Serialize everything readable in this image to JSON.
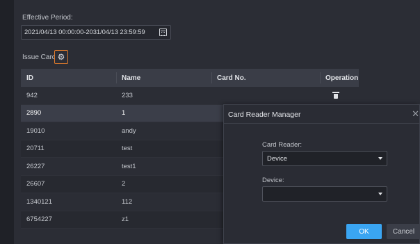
{
  "effective_period": {
    "label": "Effective Period:",
    "value": "2021/04/13 00:00:00-2031/04/13 23:59:59",
    "icon": "calendar-icon"
  },
  "issue_card": {
    "label": "Issue Card",
    "icon": "gear-icon",
    "highlight_color": "#e07b2c"
  },
  "table": {
    "headers": {
      "id": "ID",
      "name": "Name",
      "card_no": "Card No.",
      "operation": "Operation"
    },
    "rows": [
      {
        "id": "942",
        "name": "233",
        "card_no": "",
        "has_delete": true
      },
      {
        "id": "2890",
        "name": "1",
        "card_no": "",
        "selected": true
      },
      {
        "id": "19010",
        "name": "andy",
        "card_no": ""
      },
      {
        "id": "20711",
        "name": "test",
        "card_no": ""
      },
      {
        "id": "26227",
        "name": "test1",
        "card_no": ""
      },
      {
        "id": "26607",
        "name": "2",
        "card_no": ""
      },
      {
        "id": "1340121",
        "name": "112",
        "card_no": ""
      },
      {
        "id": "6754227",
        "name": "z1",
        "card_no": ""
      }
    ]
  },
  "dialog": {
    "title": "Card Reader Manager",
    "close_icon": "close-icon",
    "card_reader_label": "Card Reader:",
    "card_reader_value": "Device",
    "device_label": "Device:",
    "device_value": "",
    "ok_label": "OK",
    "cancel_label": "Cancel",
    "ok_color": "#3aa5f2"
  }
}
